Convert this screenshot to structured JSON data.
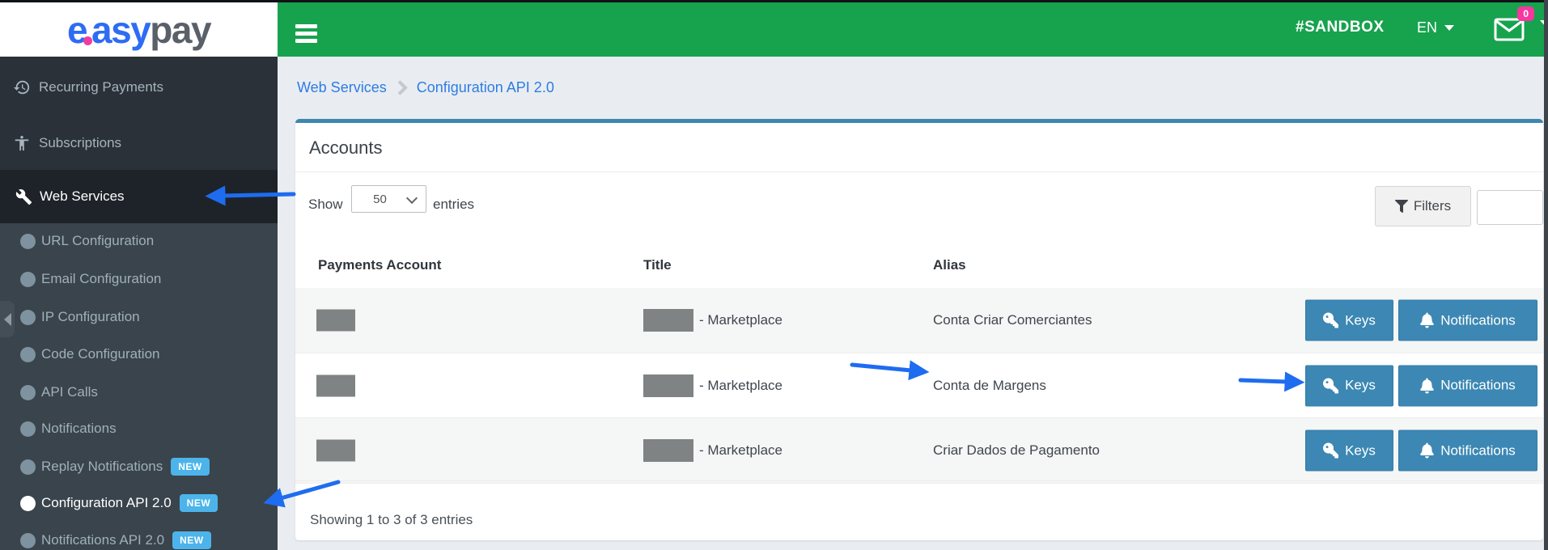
{
  "header": {
    "logo_e": "e",
    "logo_asy": "asy",
    "logo_pay": "pay",
    "sandbox_label": "#SANDBOX",
    "language": "EN",
    "mail_badge_count": "0"
  },
  "sidebar": {
    "top_items": [
      {
        "label": "Recurring Payments",
        "icon": "history-icon"
      },
      {
        "label": "Subscriptions",
        "icon": "person-icon"
      },
      {
        "label": "Web Services",
        "icon": "wrench-icon",
        "active": true
      }
    ],
    "submenu": [
      {
        "label": "URL Configuration"
      },
      {
        "label": "Email Configuration"
      },
      {
        "label": "IP Configuration"
      },
      {
        "label": "Code Configuration"
      },
      {
        "label": "API Calls"
      },
      {
        "label": "Notifications"
      },
      {
        "label": "Replay Notifications",
        "badge": "NEW"
      },
      {
        "label": "Configuration API 2.0",
        "badge": "NEW",
        "active": true
      },
      {
        "label": "Notifications API 2.0",
        "badge": "NEW"
      }
    ]
  },
  "breadcrumb": {
    "items": [
      "Web Services",
      "Configuration API 2.0"
    ]
  },
  "panel": {
    "title": "Accounts",
    "show_label": "Show",
    "page_size": "50",
    "entries_label": "entries",
    "filters_label": "Filters",
    "search_value": "",
    "footer": "Showing 1 to 3 of 3 entries"
  },
  "table": {
    "columns": [
      "Payments Account",
      "Title",
      "Alias"
    ],
    "rows": [
      {
        "payments_account_redacted": true,
        "title_redacted": true,
        "title_suffix": "- Marketplace",
        "alias": "Conta Criar Comerciantes"
      },
      {
        "payments_account_redacted": true,
        "title_redacted": true,
        "title_suffix": "- Marketplace",
        "alias": "Conta de Margens"
      },
      {
        "payments_account_redacted": true,
        "title_redacted": true,
        "title_suffix": "- Marketplace",
        "alias": "Criar Dados de Pagamento"
      }
    ],
    "actions": {
      "keys_label": "Keys",
      "notifications_label": "Notifications"
    }
  },
  "annotations": {
    "arrow_color": "#1e6cf0"
  },
  "colors": {
    "navbar_green": "#17a24e",
    "sidebar_dark": "#2a3138",
    "sidebar_active": "#1d2329",
    "submenu_bg": "#3a444c",
    "new_badge_blue": "#4cb4ea",
    "link_blue": "#2e7ce4",
    "card_accent": "#3d87b0",
    "button_blue": "#3c87b3",
    "badge_pink": "#f5379f"
  }
}
